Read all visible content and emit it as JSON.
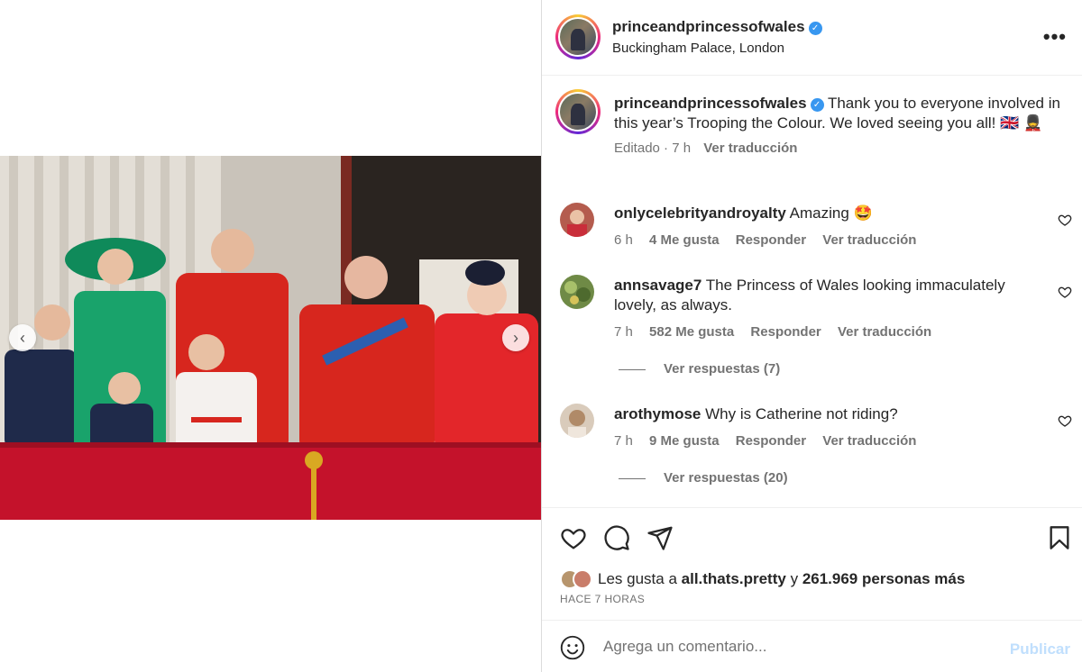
{
  "post": {
    "username": "princeandprincessofwales",
    "location": "Buckingham Palace, London",
    "more_label": "•••",
    "caption_text": "Thank you to everyone involved in this year’s Trooping the Colour. We loved seeing you all! 🇬🇧 💂",
    "caption_edited": "Editado",
    "caption_time": "7 h",
    "caption_translate": "Ver traducción"
  },
  "comments": [
    {
      "username": "onlycelebrityandroyalty",
      "text": "Amazing 🤩",
      "time": "6 h",
      "likes": "4 Me gusta",
      "reply": "Responder",
      "translate": "Ver traducción"
    },
    {
      "username": "annsavage7",
      "text": "The Princess of Wales looking immaculately lovely, as always.",
      "time": "7 h",
      "likes": "582 Me gusta",
      "reply": "Responder",
      "translate": "Ver traducción",
      "replies": "Ver respuestas (7)"
    },
    {
      "username": "arothymose",
      "text": "Why is Catherine not riding?",
      "time": "7 h",
      "likes": "9 Me gusta",
      "reply": "Responder",
      "translate": "Ver traducción",
      "replies": "Ver respuestas (20)"
    }
  ],
  "likes_bar": {
    "prefix": "Les gusta a",
    "liker": "all.thats.pretty",
    "joiner": "y",
    "others": "261.969 personas más",
    "time_ago": "HACE 7 HORAS"
  },
  "composer": {
    "placeholder": "Agrega un comentario...",
    "publish_label": "Publicar"
  },
  "icons": {
    "like": "heart-icon",
    "comment": "comment-icon",
    "share": "share-icon",
    "save": "bookmark-icon",
    "emoji": "emoji-icon",
    "carousel_prev": "chevron-left-icon",
    "carousel_next": "chevron-right-icon"
  },
  "colors": {
    "verified": "#3897f0",
    "publish_disabled": "#c0dffd",
    "muted": "#737373"
  }
}
